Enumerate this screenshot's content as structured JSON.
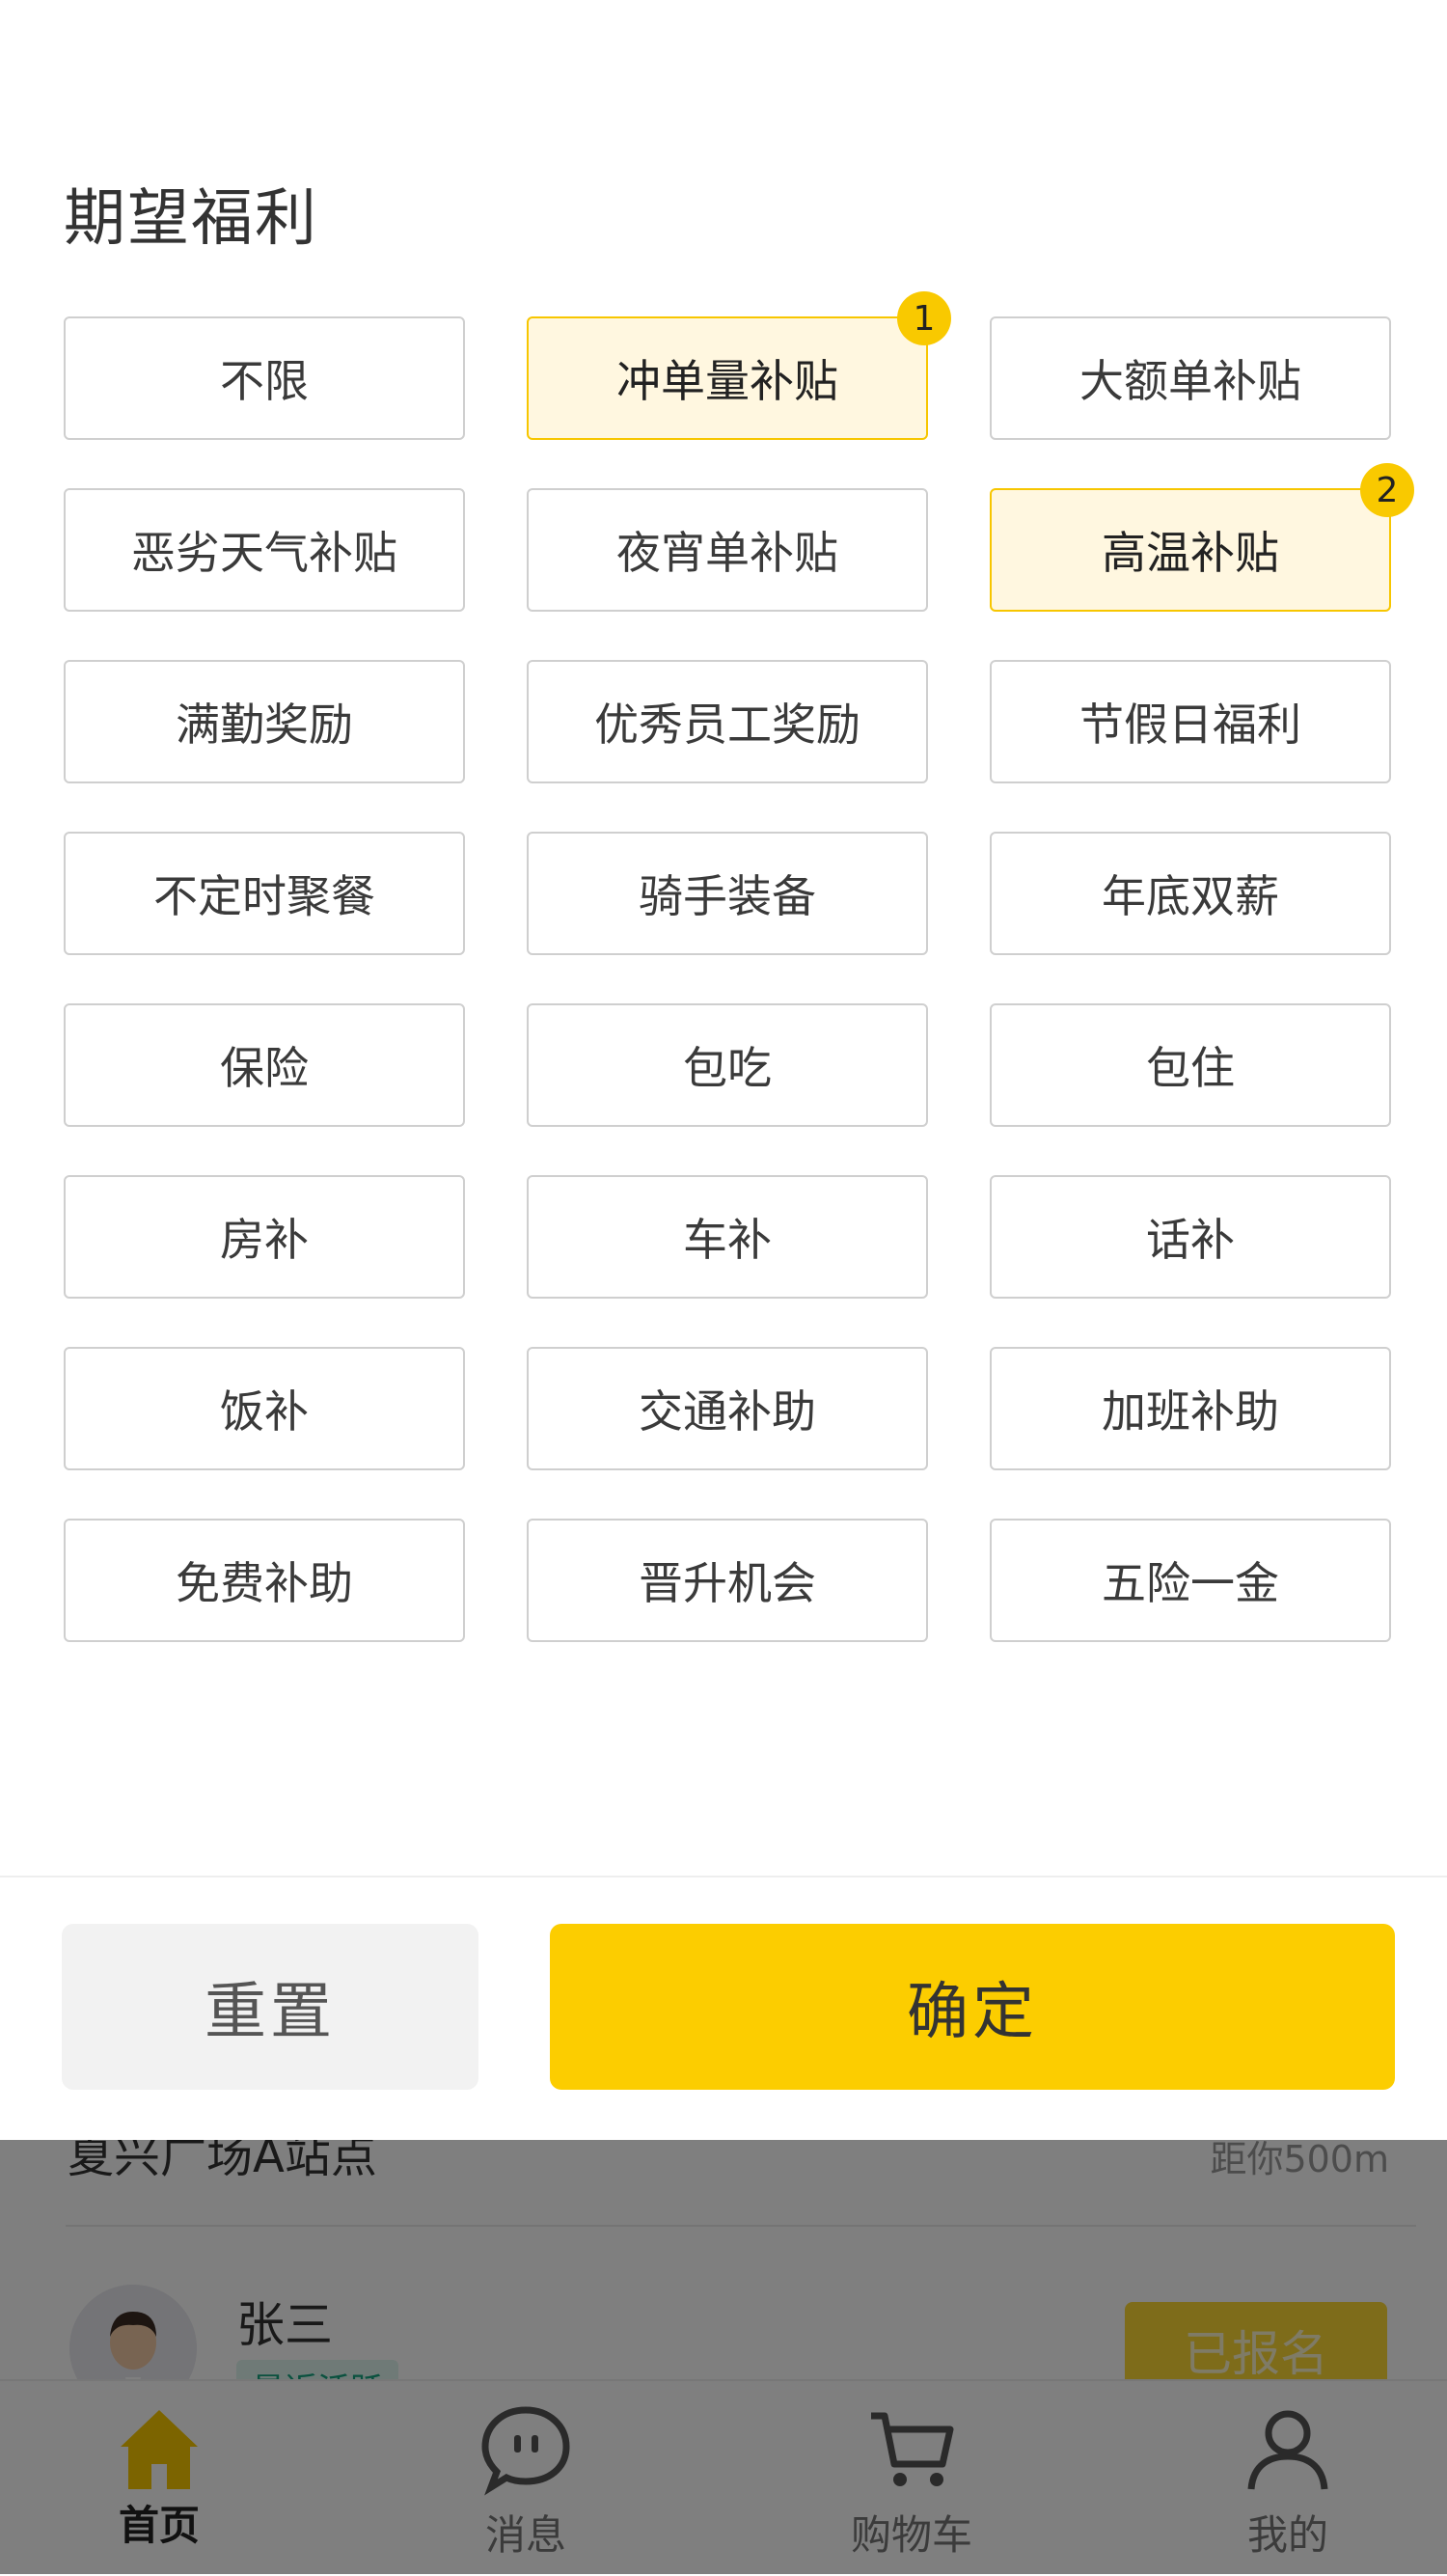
{
  "filter": {
    "title": "期望福利",
    "options": [
      {
        "label": "不限",
        "selected": false
      },
      {
        "label": "冲单量补贴",
        "selected": true,
        "badge": "1"
      },
      {
        "label": "大额单补贴",
        "selected": false
      },
      {
        "label": "恶劣天气补贴",
        "selected": false
      },
      {
        "label": "夜宵单补贴",
        "selected": false
      },
      {
        "label": "高温补贴",
        "selected": true,
        "badge": "2"
      },
      {
        "label": "满勤奖励",
        "selected": false
      },
      {
        "label": "优秀员工奖励",
        "selected": false
      },
      {
        "label": "节假日福利",
        "selected": false
      },
      {
        "label": "不定时聚餐",
        "selected": false
      },
      {
        "label": "骑手装备",
        "selected": false
      },
      {
        "label": "年底双薪",
        "selected": false
      },
      {
        "label": "保险",
        "selected": false
      },
      {
        "label": "包吃",
        "selected": false
      },
      {
        "label": "包住",
        "selected": false
      },
      {
        "label": "房补",
        "selected": false
      },
      {
        "label": "车补",
        "selected": false
      },
      {
        "label": "话补",
        "selected": false
      },
      {
        "label": "饭补",
        "selected": false
      },
      {
        "label": "交通补助",
        "selected": false
      },
      {
        "label": "加班补助",
        "selected": false
      },
      {
        "label": "免费补助",
        "selected": false
      },
      {
        "label": "晋升机会",
        "selected": false
      },
      {
        "label": "五险一金",
        "selected": false
      }
    ],
    "reset_label": "重置",
    "confirm_label": "确定"
  },
  "background": {
    "station": "夏兴广场A站点",
    "distance": "距你500m",
    "user_name": "张三",
    "active_badge": "最近活跃",
    "registered_label": "已报名"
  },
  "tabbar": {
    "items": [
      {
        "label": "首页",
        "icon": "home-icon",
        "active": true
      },
      {
        "label": "消息",
        "icon": "message-icon",
        "active": false
      },
      {
        "label": "购物车",
        "icon": "cart-icon",
        "active": false
      },
      {
        "label": "我的",
        "icon": "user-icon",
        "active": false
      }
    ]
  },
  "colors": {
    "accent": "#fccd00",
    "selected_bg": "#fff7e0",
    "selected_border": "#f7c600",
    "badge": "#f9c900"
  }
}
